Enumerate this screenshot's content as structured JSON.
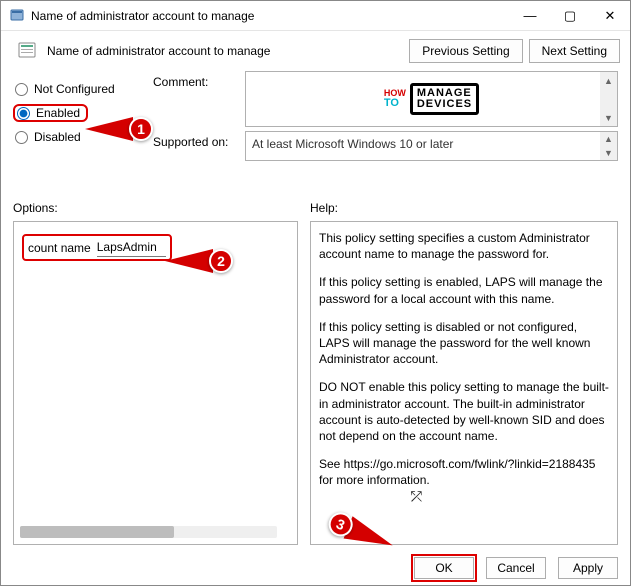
{
  "window": {
    "title": "Name of administrator account to manage",
    "minimize_glyph": "—",
    "maximize_glyph": "▢",
    "close_glyph": "✕"
  },
  "subheader": {
    "text": "Name of administrator account to manage",
    "prev_btn": "Previous Setting",
    "next_btn": "Next Setting"
  },
  "radios": {
    "not_configured": "Not Configured",
    "enabled": "Enabled",
    "disabled": "Disabled",
    "selected": "enabled"
  },
  "labels": {
    "comment": "Comment:",
    "supported_on": "Supported on:",
    "options": "Options:",
    "help": "Help:"
  },
  "supported_on_text": "At least Microsoft Windows 10 or later",
  "logo": {
    "line1_small": "HOW",
    "line1_big": "TO",
    "boxed_top": "MANAGE",
    "boxed_bottom": "DEVICES"
  },
  "options": {
    "field_label": "count name",
    "field_value": "LapsAdmin"
  },
  "help": {
    "p1": "This policy setting specifies a custom Administrator account name to manage the password for.",
    "p2": "If this policy setting is enabled, LAPS will manage the password for a local account with this name.",
    "p3": "If this policy setting is disabled or not configured, LAPS will manage the password for the well known Administrator account.",
    "p4": "DO NOT enable this policy setting to manage the built-in administrator account. The built-in administrator account is auto-detected by well-known SID and does not depend on the account name.",
    "p5": "See https://go.microsoft.com/fwlink/?linkid=2188435 for more information."
  },
  "footer": {
    "ok": "OK",
    "cancel": "Cancel",
    "apply": "Apply"
  },
  "markers": {
    "m1": "1",
    "m2": "2",
    "m3": "3"
  },
  "scroll": {
    "up": "▲",
    "down": "▼"
  }
}
